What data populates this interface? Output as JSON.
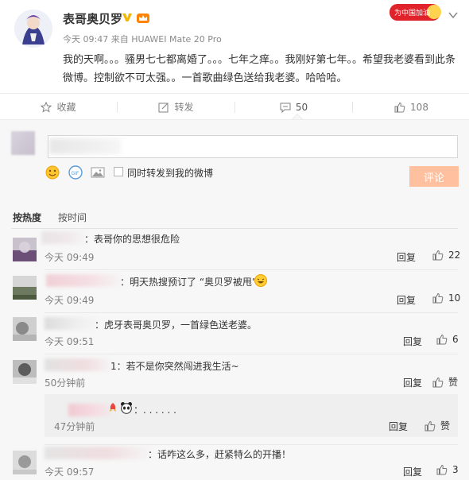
{
  "post": {
    "author": "表哥奥贝罗",
    "meta": "今天 09:47 来自 HUAWEI Mate 20 Pro",
    "text": "我的天啊。。。骚男七七都离婚了。。。七年之痒。。我刚好第七年。。希望我老婆看到此条微博。控制欲不可太强。。一首歌曲绿色送给我老婆。哈哈哈。",
    "top_badge": "为中国加油",
    "icons": [
      "avatar",
      "verified-v-icon",
      "vip-crown-icon",
      "chevron-down-icon"
    ]
  },
  "actions": {
    "favorite_label": "收藏",
    "forward_label": "转发",
    "comment_count": "50",
    "like_count": "108"
  },
  "composer": {
    "placeholder": "",
    "forward_label": "同时转发到我的微博",
    "submit_label": "评论",
    "submit_color": "#ffc09f"
  },
  "sort": {
    "hot": "按热度",
    "time": "按时间"
  },
  "comments": [
    {
      "text": "：表哥你的思想很危险",
      "time": "今天 09:49",
      "reply": "回复",
      "likes": "22"
    },
    {
      "text": "：明天热搜预订了 “奥贝罗被甩”",
      "time": "今天 09:49",
      "reply": "回复",
      "likes": "10"
    },
    {
      "text": "：虎牙表哥奥贝罗，一首绿色送老婆。",
      "time": "今天 09:51",
      "reply": "回复",
      "likes": "6"
    },
    {
      "text": "1：若不是你突然闯进我生活~",
      "time": "50分钟前",
      "reply": "回复",
      "likes": "赞"
    },
    {
      "text": "：. . . . . .",
      "time": "47分钟前",
      "reply": "回复",
      "likes": "赞"
    },
    {
      "text": "：话咋这么多，赶紧特么的开播！",
      "time": "今天 09:57",
      "reply": "回复",
      "likes": "3"
    }
  ],
  "accent": "#fa7d3c"
}
